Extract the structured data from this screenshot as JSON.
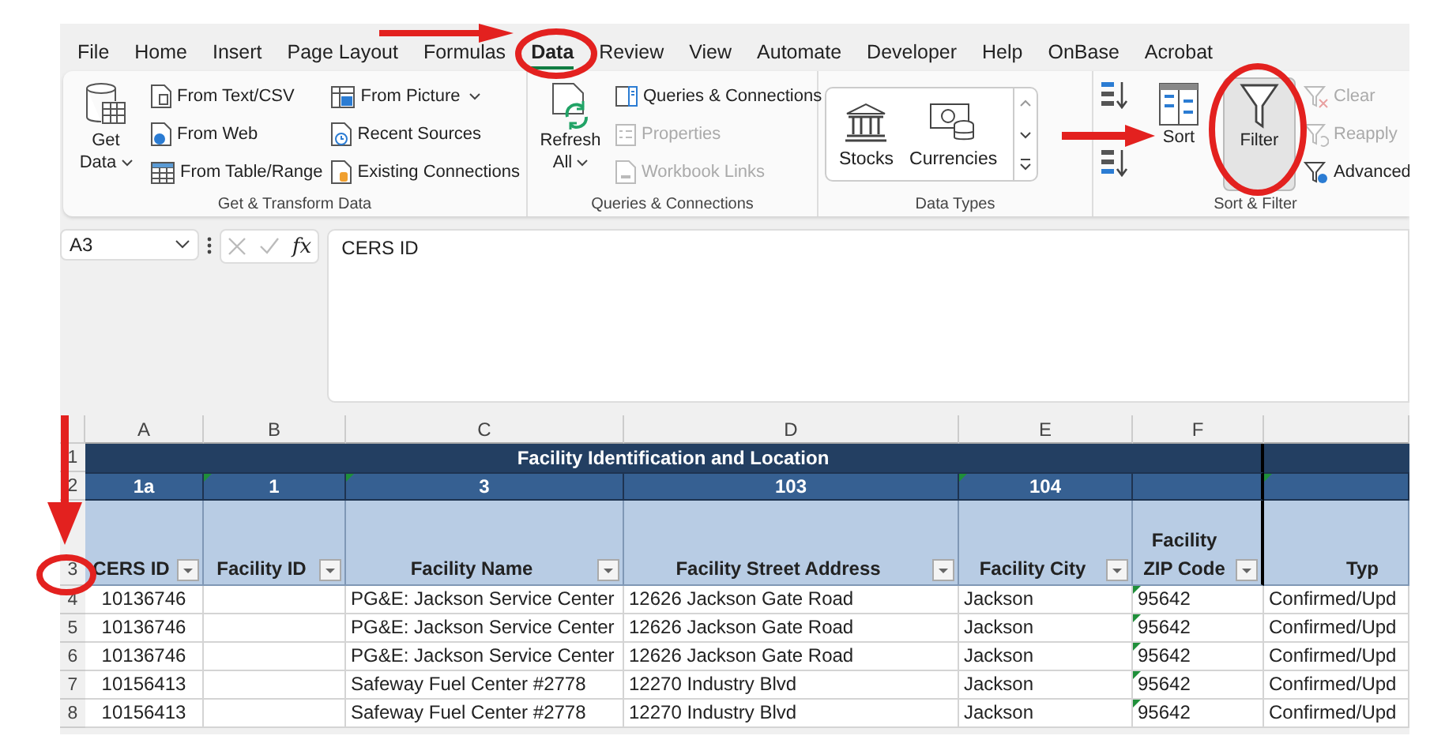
{
  "menu_tabs": [
    {
      "label": "File",
      "selected": false
    },
    {
      "label": "Home",
      "selected": false
    },
    {
      "label": "Insert",
      "selected": false
    },
    {
      "label": "Page Layout",
      "selected": false
    },
    {
      "label": "Formulas",
      "selected": false
    },
    {
      "label": "Data",
      "selected": true
    },
    {
      "label": "Review",
      "selected": false
    },
    {
      "label": "View",
      "selected": false
    },
    {
      "label": "Automate",
      "selected": false
    },
    {
      "label": "Developer",
      "selected": false
    },
    {
      "label": "Help",
      "selected": false
    },
    {
      "label": "OnBase",
      "selected": false
    },
    {
      "label": "Acrobat",
      "selected": false
    }
  ],
  "ribbon_groups": [
    {
      "label": "Get & Transform Data",
      "items": [
        {
          "kind": "large",
          "label": "Get Data",
          "dropdown": true,
          "disabled": false
        },
        {
          "kind": "small",
          "label": "From Text/CSV",
          "dropdown": false,
          "disabled": false
        },
        {
          "kind": "small",
          "label": "From Web",
          "dropdown": false,
          "disabled": false
        },
        {
          "kind": "small",
          "label": "From Table/Range",
          "dropdown": false,
          "disabled": false
        },
        {
          "kind": "small",
          "label": "From Picture",
          "dropdown": true,
          "disabled": false
        },
        {
          "kind": "small",
          "label": "Recent Sources",
          "dropdown": false,
          "disabled": false
        },
        {
          "kind": "small",
          "label": "Existing Connections",
          "dropdown": false,
          "disabled": false
        }
      ]
    },
    {
      "label": "Queries & Connections",
      "items": [
        {
          "kind": "large",
          "label": "Refresh All",
          "dropdown": true,
          "disabled": false
        },
        {
          "kind": "small",
          "label": "Queries & Connections",
          "dropdown": false,
          "disabled": false
        },
        {
          "kind": "small",
          "label": "Properties",
          "dropdown": false,
          "disabled": true
        },
        {
          "kind": "small",
          "label": "Workbook Links",
          "dropdown": false,
          "disabled": true
        }
      ]
    },
    {
      "label": "Data Types",
      "items": [
        {
          "kind": "gallery",
          "label": "Stocks"
        },
        {
          "kind": "gallery",
          "label": "Currencies"
        }
      ]
    },
    {
      "label": "Sort & Filter",
      "items": [
        {
          "kind": "icon"
        },
        {
          "kind": "icon"
        },
        {
          "kind": "large",
          "label": "Sort",
          "disabled": false,
          "pressed": false
        },
        {
          "kind": "large",
          "label": "Filter",
          "disabled": false,
          "pressed": true
        },
        {
          "kind": "small",
          "label": "Clear",
          "disabled": true
        },
        {
          "kind": "small",
          "label": "Reapply",
          "disabled": true
        },
        {
          "kind": "small",
          "label": "Advanced",
          "disabled": false
        }
      ]
    }
  ],
  "formula_bar": {
    "name_box": "A3",
    "function_label": "fx",
    "formula": "CERS ID"
  },
  "sheet": {
    "group_title": "Facility Identification and Location",
    "header_row_numbers": [
      "1",
      "2",
      "3"
    ],
    "columns": [
      {
        "letter": "A",
        "code": "1a",
        "code_mark": false,
        "heading": "CERS ID",
        "filter": true,
        "cells_marked": false
      },
      {
        "letter": "B",
        "code": "1",
        "code_mark": true,
        "heading": "Facility ID",
        "filter": true,
        "cells_marked": false
      },
      {
        "letter": "C",
        "code": "3",
        "code_mark": true,
        "heading": "Facility Name",
        "filter": true,
        "cells_marked": false
      },
      {
        "letter": "D",
        "code": "103",
        "code_mark": false,
        "heading": "Facility Street Address",
        "filter": true,
        "cells_marked": false
      },
      {
        "letter": "E",
        "code": "104",
        "code_mark": true,
        "heading": "Facility City",
        "filter": true,
        "cells_marked": false
      },
      {
        "letter": "F",
        "code_mark": false,
        "heading": "Facility\nZIP Code",
        "filter": true,
        "cells_marked": true
      },
      {
        "code_mark": true,
        "heading": "Typ",
        "filter": false,
        "cells_marked": false
      }
    ],
    "rows": [
      {
        "number": "4",
        "cells": [
          "10136746",
          "",
          "PG&E: Jackson Service Center",
          "12626 Jackson Gate Road",
          "Jackson",
          "95642",
          "Confirmed/Upd"
        ]
      },
      {
        "number": "5",
        "cells": [
          "10136746",
          "",
          "PG&E: Jackson Service Center",
          "12626 Jackson Gate Road",
          "Jackson",
          "95642",
          "Confirmed/Upd"
        ]
      },
      {
        "number": "6",
        "cells": [
          "10136746",
          "",
          "PG&E: Jackson Service Center",
          "12626 Jackson Gate Road",
          "Jackson",
          "95642",
          "Confirmed/Upd"
        ]
      },
      {
        "number": "7",
        "cells": [
          "10156413",
          "",
          "Safeway Fuel Center #2778",
          "12270 Industry Blvd",
          "Jackson",
          "95642",
          "Confirmed/Upd"
        ]
      },
      {
        "number": "8",
        "cells": [
          "10156413",
          "",
          "Safeway Fuel Center #2778",
          "12270 Industry Blvd",
          "Jackson",
          "95642",
          "Confirmed/Upd"
        ]
      }
    ]
  }
}
